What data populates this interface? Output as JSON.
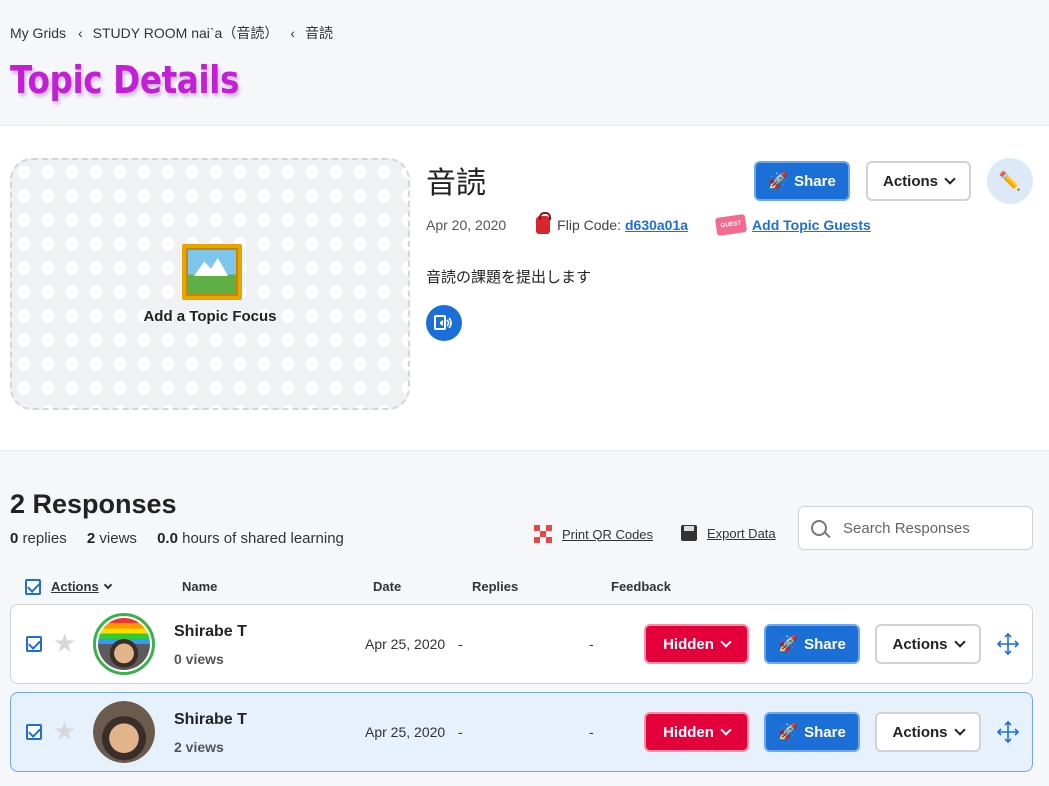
{
  "breadcrumb": {
    "items": [
      "My Grids",
      "STUDY ROOM nai`a（音読）",
      "音読"
    ]
  },
  "page_title": "Topic Details",
  "topic": {
    "focus_label": "Add a Topic Focus",
    "title": "音読",
    "date": "Apr 20, 2020",
    "flip_code_label": "Flip Code:",
    "flip_code": "d630a01a",
    "guest_badge": "GUEST",
    "add_guests_label": "Add Topic Guests",
    "description": "音読の課題を提出します",
    "share_label": "Share",
    "actions_label": "Actions"
  },
  "responses": {
    "title": "2 Responses",
    "stats": {
      "replies_count": "0",
      "replies_label": "replies",
      "views_count": "2",
      "views_label": "views",
      "hours_count": "0.0",
      "hours_label": "hours of shared learning"
    },
    "print_qr_label": "Print QR Codes",
    "export_label": "Export Data",
    "search_placeholder": "Search Responses",
    "columns": {
      "actions": "Actions",
      "name": "Name",
      "date": "Date",
      "replies": "Replies",
      "feedback": "Feedback"
    },
    "rows": [
      {
        "name": "Shirabe T",
        "views": "0 views",
        "date": "Apr 25, 2020",
        "replies": "-",
        "feedback": "-",
        "status_label": "Hidden",
        "share_label": "Share",
        "actions_label": "Actions",
        "checked": true,
        "selected": false
      },
      {
        "name": "Shirabe T",
        "views": "2 views",
        "date": "Apr 25, 2020",
        "replies": "-",
        "feedback": "-",
        "status_label": "Hidden",
        "share_label": "Share",
        "actions_label": "Actions",
        "checked": true,
        "selected": true
      }
    ]
  },
  "colors": {
    "title_accent": "#c31fd6",
    "primary_blue": "#1b6fd6",
    "hidden_red": "#e4003a",
    "avatar_ring_green": "#38b24a"
  }
}
